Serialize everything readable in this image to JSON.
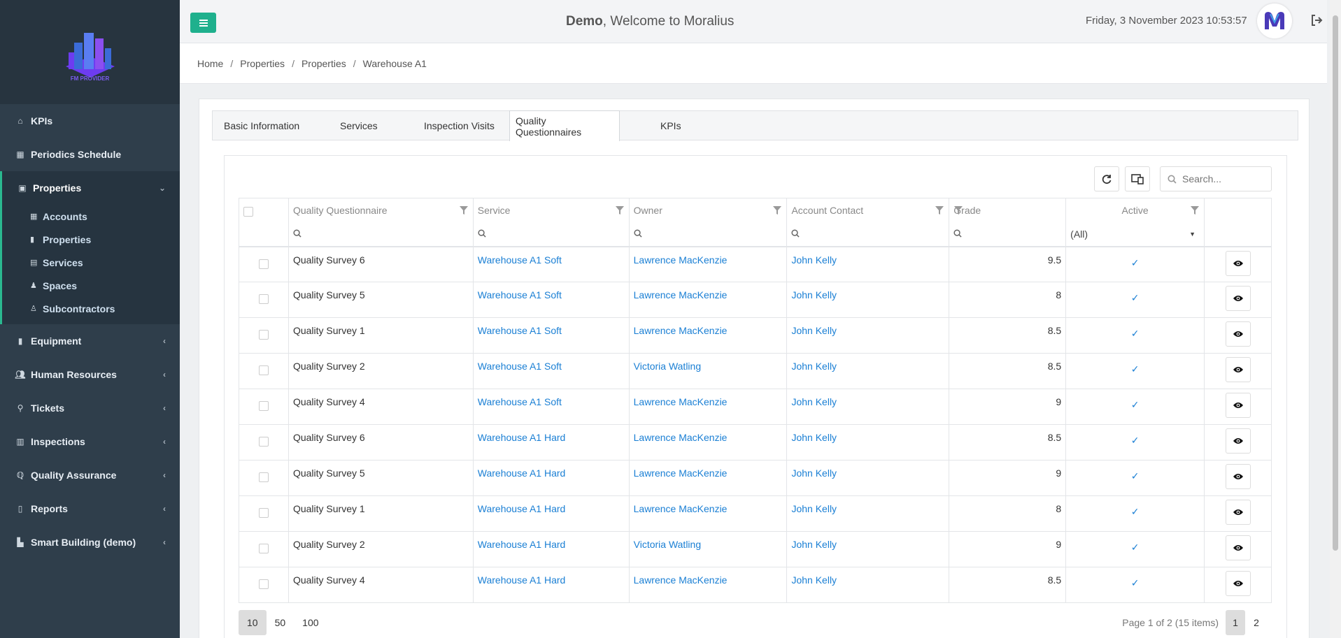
{
  "logo": {
    "caption": "FM PROVIDER"
  },
  "sidebar": {
    "items": [
      {
        "label": "KPIs",
        "icon": "home-icon"
      },
      {
        "label": "Periodics Schedule",
        "icon": "calendar-icon"
      },
      {
        "label": "Properties",
        "icon": "calculator-icon",
        "expanded": true,
        "children": [
          {
            "label": "Accounts",
            "icon": "calculator-icon"
          },
          {
            "label": "Properties",
            "icon": "building-icon"
          },
          {
            "label": "Services",
            "icon": "calendar-check-icon"
          },
          {
            "label": "Spaces",
            "icon": "bell-icon"
          },
          {
            "label": "Subcontractors",
            "icon": "user-tie-icon"
          }
        ]
      },
      {
        "label": "Equipment",
        "icon": "building-icon"
      },
      {
        "label": "Human Resources",
        "icon": "users-icon"
      },
      {
        "label": "Tickets",
        "icon": "broom-icon"
      },
      {
        "label": "Inspections",
        "icon": "map-icon"
      },
      {
        "label": "Quality Assurance",
        "icon": "search-quality-icon"
      },
      {
        "label": "Reports",
        "icon": "book-icon"
      },
      {
        "label": "Smart Building (demo)",
        "icon": "chart-icon"
      }
    ]
  },
  "header": {
    "user": "Demo",
    "welcome": ", Welcome to Moralius",
    "datetime": "Friday, 3 November 2023 10:53:57"
  },
  "breadcrumb": [
    "Home",
    "Properties",
    "Properties",
    "Warehouse A1"
  ],
  "tabs": [
    "Basic Information",
    "Services",
    "Inspection Visits",
    "Quality Questionnaires",
    "KPIs"
  ],
  "active_tab": "Quality Questionnaires",
  "search": {
    "placeholder": "Search..."
  },
  "table": {
    "columns": [
      "Quality Questionnaire",
      "Service",
      "Owner",
      "Account Contact",
      "Grade",
      "Active"
    ],
    "active_filter": "(All)",
    "rows": [
      {
        "questionnaire": "Quality Survey 6",
        "service": "Warehouse A1 Soft",
        "owner": "Lawrence MacKenzie",
        "contact": "John Kelly",
        "grade": "9.5"
      },
      {
        "questionnaire": "Quality Survey 5",
        "service": "Warehouse A1 Soft",
        "owner": "Lawrence MacKenzie",
        "contact": "John Kelly",
        "grade": "8"
      },
      {
        "questionnaire": "Quality Survey 1",
        "service": "Warehouse A1 Soft",
        "owner": "Lawrence MacKenzie",
        "contact": "John Kelly",
        "grade": "8.5"
      },
      {
        "questionnaire": "Quality Survey 2",
        "service": "Warehouse A1 Soft",
        "owner": "Victoria Watling",
        "contact": "John Kelly",
        "grade": "8.5"
      },
      {
        "questionnaire": "Quality Survey 4",
        "service": "Warehouse A1 Soft",
        "owner": "Lawrence MacKenzie",
        "contact": "John Kelly",
        "grade": "9"
      },
      {
        "questionnaire": "Quality Survey 6",
        "service": "Warehouse A1 Hard",
        "owner": "Lawrence MacKenzie",
        "contact": "John Kelly",
        "grade": "8.5"
      },
      {
        "questionnaire": "Quality Survey 5",
        "service": "Warehouse A1 Hard",
        "owner": "Lawrence MacKenzie",
        "contact": "John Kelly",
        "grade": "9"
      },
      {
        "questionnaire": "Quality Survey 1",
        "service": "Warehouse A1 Hard",
        "owner": "Lawrence MacKenzie",
        "contact": "John Kelly",
        "grade": "8"
      },
      {
        "questionnaire": "Quality Survey 2",
        "service": "Warehouse A1 Hard",
        "owner": "Victoria Watling",
        "contact": "John Kelly",
        "grade": "9"
      },
      {
        "questionnaire": "Quality Survey 4",
        "service": "Warehouse A1 Hard",
        "owner": "Lawrence MacKenzie",
        "contact": "John Kelly",
        "grade": "8.5"
      }
    ]
  },
  "pager": {
    "sizes": [
      "10",
      "50",
      "100"
    ],
    "active_size": "10",
    "info": "Page 1 of 2 (15 items)",
    "pages": [
      "1",
      "2"
    ],
    "current_page": "1"
  },
  "colors": {
    "accent": "#1fb08d",
    "link": "#1a7fd4",
    "sidebar": "#2f3e4b"
  }
}
